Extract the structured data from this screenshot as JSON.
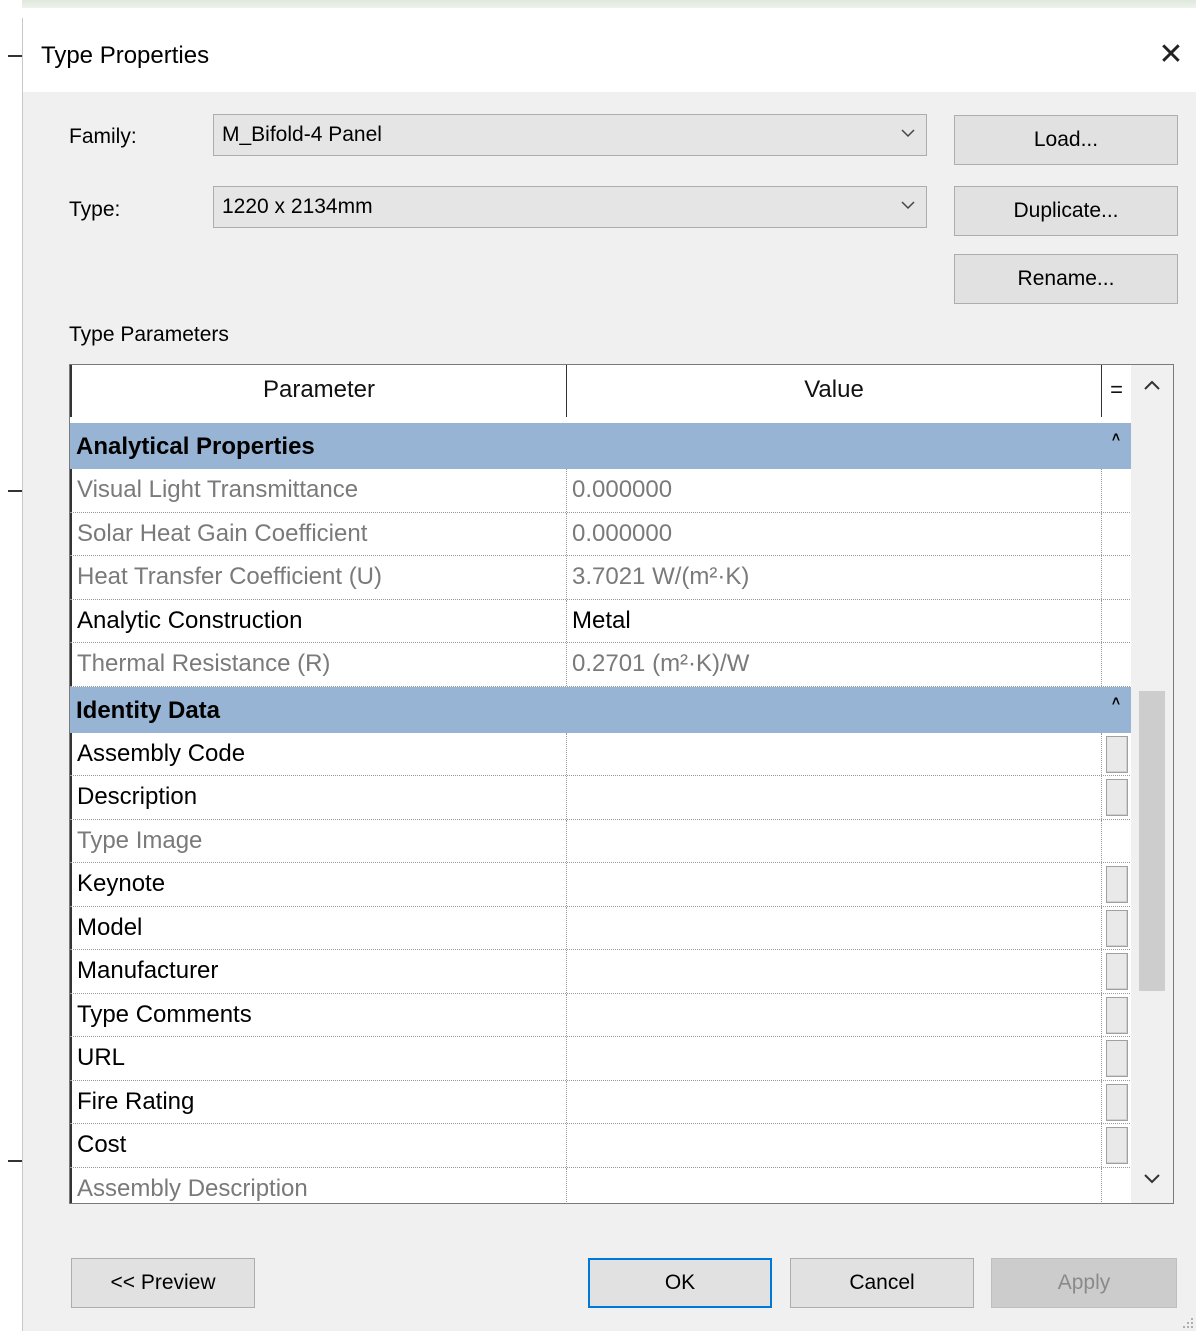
{
  "dialog": {
    "title": "Type Properties",
    "close_glyph": "✕"
  },
  "family": {
    "label": "Family:",
    "value": "M_Bifold-4 Panel"
  },
  "type": {
    "label": "Type:",
    "value": "1220 x 2134mm"
  },
  "buttons": {
    "load": "Load...",
    "duplicate": "Duplicate...",
    "rename": "Rename...",
    "preview": "<< Preview",
    "ok": "OK",
    "cancel": "Cancel",
    "apply": "Apply"
  },
  "type_parameters_label": "Type Parameters",
  "table": {
    "header": {
      "parameter": "Parameter",
      "value": "Value",
      "equals": "="
    },
    "groups": [
      {
        "name": "Analytical Properties",
        "collapse_glyph": "˄",
        "rows": [
          {
            "parameter": "Visual Light Transmittance",
            "value": "0.000000",
            "editable": false,
            "has_button": false
          },
          {
            "parameter": "Solar Heat Gain Coefficient",
            "value": "0.000000",
            "editable": false,
            "has_button": false
          },
          {
            "parameter": "Heat Transfer Coefficient (U)",
            "value": "3.7021 W/(m²·K)",
            "editable": false,
            "has_button": false
          },
          {
            "parameter": "Analytic Construction",
            "value": "Metal",
            "editable": true,
            "has_button": false
          },
          {
            "parameter": "Thermal Resistance (R)",
            "value": "0.2701 (m²·K)/W",
            "editable": false,
            "has_button": false
          }
        ]
      },
      {
        "name": "Identity Data",
        "collapse_glyph": "˄",
        "rows": [
          {
            "parameter": "Assembly Code",
            "value": "",
            "editable": true,
            "has_button": true
          },
          {
            "parameter": "Description",
            "value": "",
            "editable": true,
            "has_button": true
          },
          {
            "parameter": "Type Image",
            "value": "",
            "editable": false,
            "has_button": false
          },
          {
            "parameter": "Keynote",
            "value": "",
            "editable": true,
            "has_button": true
          },
          {
            "parameter": "Model",
            "value": "",
            "editable": true,
            "has_button": true
          },
          {
            "parameter": "Manufacturer",
            "value": "",
            "editable": true,
            "has_button": true
          },
          {
            "parameter": "Type Comments",
            "value": "",
            "editable": true,
            "has_button": true
          },
          {
            "parameter": "URL",
            "value": "",
            "editable": true,
            "has_button": true
          },
          {
            "parameter": "Fire Rating",
            "value": "",
            "editable": true,
            "has_button": true
          },
          {
            "parameter": "Cost",
            "value": "",
            "editable": true,
            "has_button": true
          },
          {
            "parameter": "Assembly Description",
            "value": "",
            "editable": false,
            "has_button": false
          }
        ]
      }
    ]
  },
  "icons": {
    "combo_arrow": "chevron-down-icon",
    "scroll_up": "chevron-up-icon",
    "scroll_down": "chevron-down-icon",
    "close": "close-icon"
  },
  "colors": {
    "group_header": "#98b4d4",
    "primary_border": "#0078d7",
    "dialog_bg": "#f0f0f0"
  }
}
